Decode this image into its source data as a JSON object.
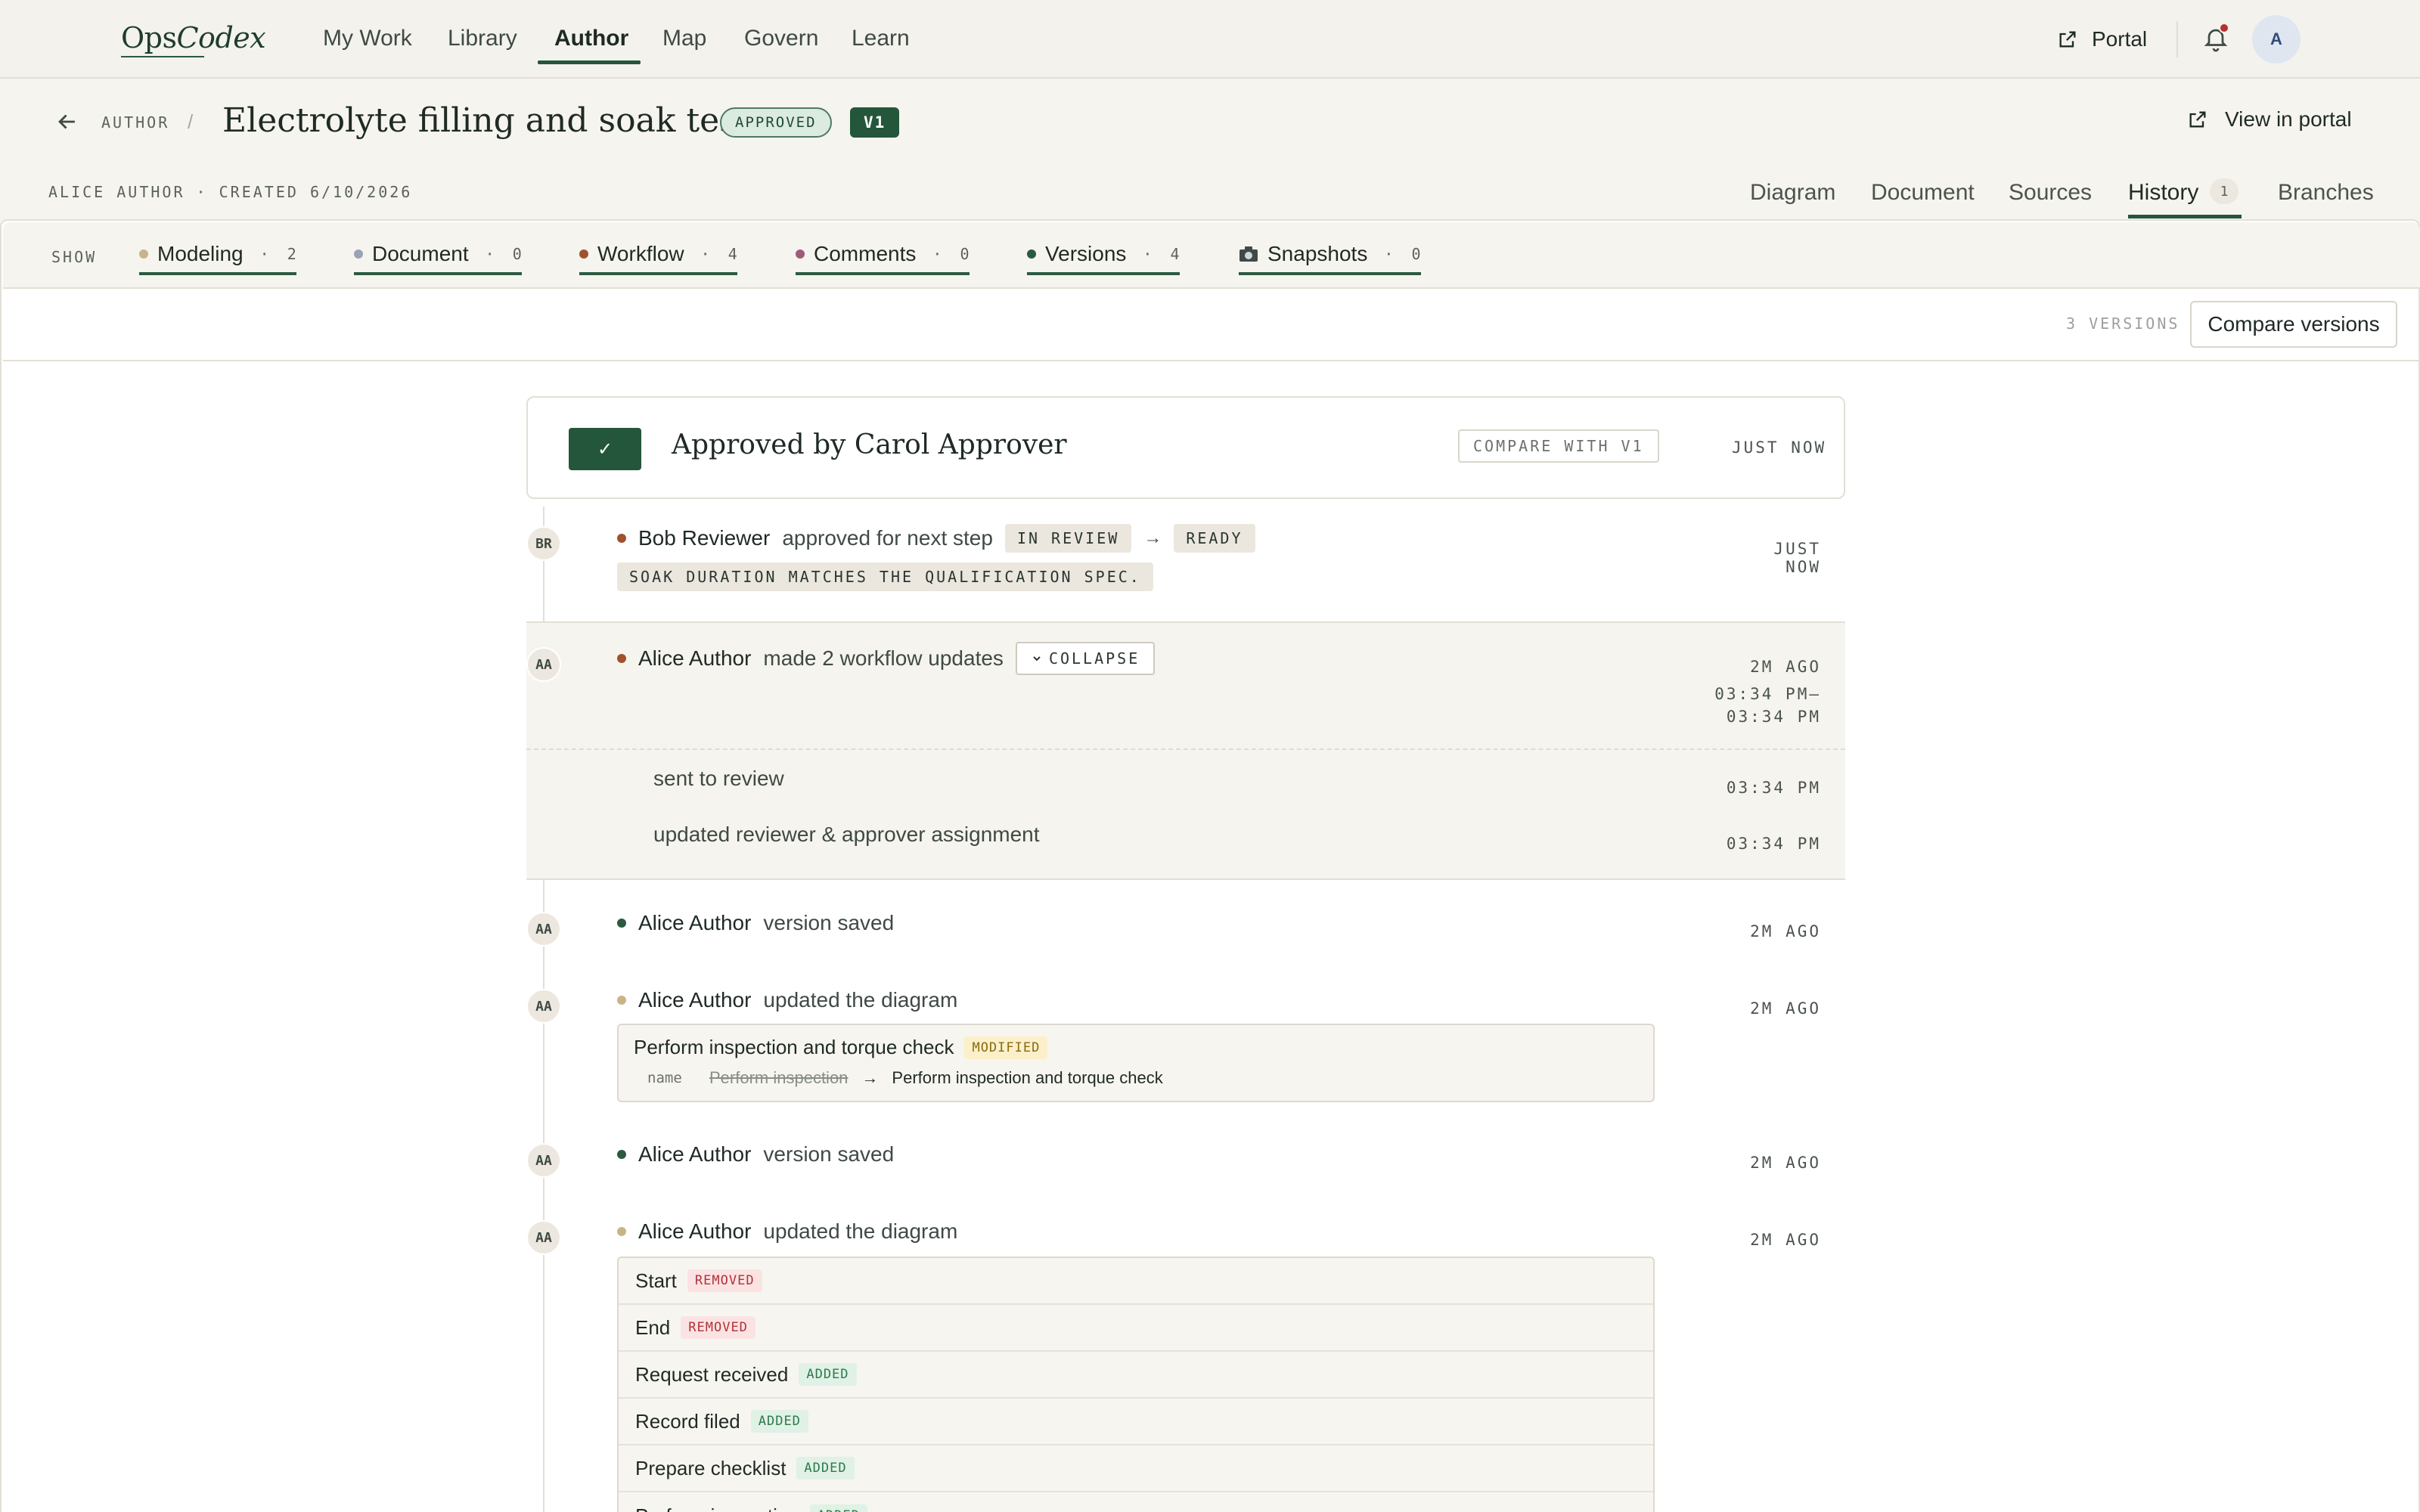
{
  "app": {
    "logo_plain": "Ops",
    "logo_italic": "Codex"
  },
  "nav": {
    "items": [
      {
        "label": "My Work"
      },
      {
        "label": "Library"
      },
      {
        "label": "Author"
      },
      {
        "label": "Map"
      },
      {
        "label": "Govern"
      },
      {
        "label": "Learn"
      }
    ],
    "active": "Author",
    "portal_label": "Portal",
    "avatar_initial": "A"
  },
  "header": {
    "breadcrumb": "AUTHOR",
    "breadcrumb_sep": "/",
    "title": "Electrolyte filling and soak test",
    "status_badge": "APPROVED",
    "version_badge": "V1",
    "view_portal_label": "View in portal",
    "meta": "ALICE AUTHOR · CREATED 6/10/2026",
    "tabs": [
      {
        "label": "Diagram"
      },
      {
        "label": "Document"
      },
      {
        "label": "Sources"
      },
      {
        "label": "History",
        "count": "1"
      },
      {
        "label": "Branches"
      }
    ],
    "active_tab": "History"
  },
  "filters": {
    "show_label": "SHOW",
    "chips": [
      {
        "label": "Modeling",
        "count": "2",
        "color": "#c9b48a"
      },
      {
        "label": "Document",
        "count": "0",
        "color": "#9aa3b5"
      },
      {
        "label": "Workflow",
        "count": "4",
        "color": "#a0522d"
      },
      {
        "label": "Comments",
        "count": "0",
        "color": "#a05a7a"
      },
      {
        "label": "Versions",
        "count": "4",
        "color": "#2b5a40"
      },
      {
        "label": "Snapshots",
        "count": "0",
        "icon": "camera-icon"
      }
    ],
    "sep": "·"
  },
  "versions": {
    "count_label": "3 VERSIONS",
    "compare_label": "Compare versions"
  },
  "timeline": {
    "approved": {
      "check": "✓",
      "title": "Approved by Carol Approver",
      "compare_label": "COMPARE WITH V1",
      "time": "JUST NOW"
    },
    "review": {
      "initials": "BR",
      "actor": "Bob Reviewer",
      "action": "approved for next step",
      "from": "IN REVIEW",
      "arrow": "→",
      "to": "READY",
      "note": "SOAK DURATION MATCHES THE QUALIFICATION SPEC.",
      "time": "JUST NOW"
    },
    "workflow_group": {
      "initials": "AA",
      "actor": "Alice Author",
      "action": "made 2 workflow updates",
      "collapse_label": "COLLAPSE",
      "time": "2M AGO",
      "range_1": "03:34 PM–",
      "range_2": "03:34 PM",
      "items": [
        {
          "text": "sent to review",
          "time": "03:34 PM"
        },
        {
          "text": "updated reviewer & approver assignment",
          "time": "03:34 PM"
        }
      ]
    },
    "saved_1": {
      "initials": "AA",
      "actor": "Alice Author",
      "action": "version saved",
      "time": "2M AGO"
    },
    "diagram_1": {
      "initials": "AA",
      "actor": "Alice Author",
      "action": "updated the diagram",
      "time": "2M AGO",
      "node": "Perform inspection and torque check",
      "tag": "MODIFIED",
      "field": "name",
      "old": "Perform inspection",
      "arrow": "→",
      "new": "Perform inspection and torque check"
    },
    "saved_2": {
      "initials": "AA",
      "actor": "Alice Author",
      "action": "version saved",
      "time": "2M AGO"
    },
    "diagram_2": {
      "initials": "AA",
      "actor": "Alice Author",
      "action": "updated the diagram",
      "time": "2M AGO",
      "changes": [
        {
          "name": "Start",
          "tag": "REMOVED"
        },
        {
          "name": "End",
          "tag": "REMOVED"
        },
        {
          "name": "Request received",
          "tag": "ADDED"
        },
        {
          "name": "Record filed",
          "tag": "ADDED"
        },
        {
          "name": "Prepare checklist",
          "tag": "ADDED"
        },
        {
          "name": "Perform inspection",
          "tag": "ADDED"
        }
      ]
    }
  },
  "colors": {
    "accent": "#24563b",
    "workflow_dot": "#a0522d",
    "version_dot": "#2b5a40",
    "modeling_dot": "#c9b48a"
  }
}
